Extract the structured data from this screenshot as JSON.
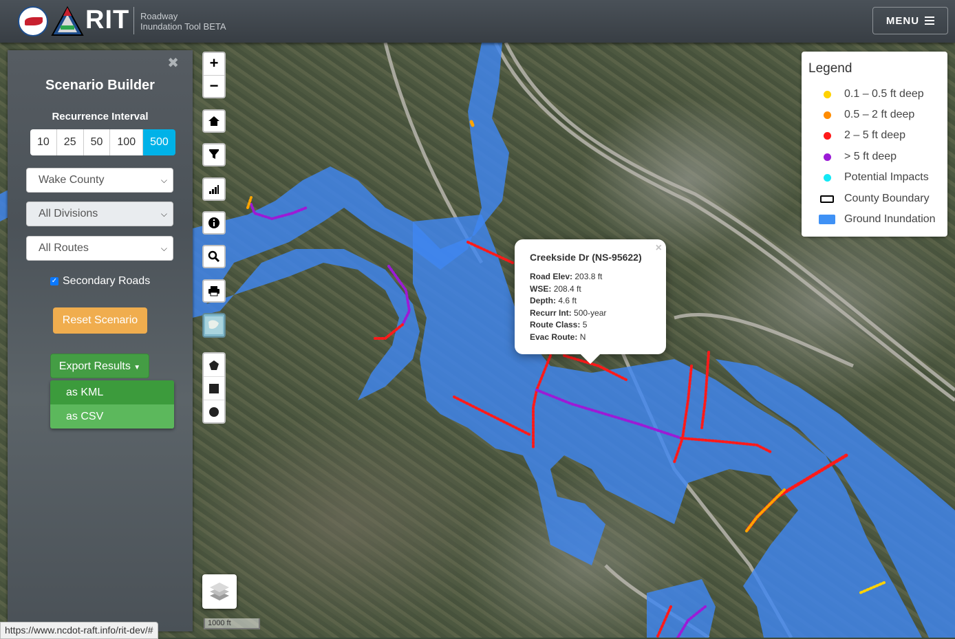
{
  "header": {
    "app_name": "RIT",
    "subtitle_line1": "Roadway",
    "subtitle_line2": "Inundation Tool BETA",
    "menu_label": "MENU"
  },
  "panel": {
    "title": "Scenario Builder",
    "close_glyph": "✖",
    "recurrence_label": "Recurrence Interval",
    "recurrence_options": [
      "10",
      "25",
      "50",
      "100",
      "500"
    ],
    "recurrence_selected": "500",
    "county_select": "Wake County",
    "division_select": "All Divisions",
    "route_select": "All Routes",
    "secondary_roads_label": "Secondary Roads",
    "secondary_roads_checked": true,
    "reset_label": "Reset Scenario",
    "export_label": "Export Results",
    "export_options": [
      "as KML",
      "as CSV"
    ]
  },
  "tools": {
    "zoom_in": "+",
    "zoom_out": "−",
    "icons": [
      "home-icon",
      "filter-icon",
      "chart-icon",
      "info-icon",
      "search-icon",
      "print-icon",
      "minimap-icon",
      "polygon-icon",
      "square-icon",
      "circle-icon",
      "layers-icon"
    ]
  },
  "legend": {
    "title": "Legend",
    "items": [
      {
        "label": "0.1 – 0.5 ft deep",
        "color": "#ffd200",
        "symbol": "dot"
      },
      {
        "label": "0.5 – 2 ft deep",
        "color": "#ff8c00",
        "symbol": "dot"
      },
      {
        "label": "2 – 5 ft deep",
        "color": "#ff1a1a",
        "symbol": "dot"
      },
      {
        "label": "> 5 ft deep",
        "color": "#9b1bd6",
        "symbol": "dot"
      },
      {
        "label": "Potential Impacts",
        "color": "#14e8f5",
        "symbol": "dot"
      },
      {
        "label": "County Boundary",
        "color": "#000000",
        "symbol": "outline"
      },
      {
        "label": "Ground Inundation",
        "color": "#3f91f5",
        "symbol": "fill"
      }
    ]
  },
  "popup": {
    "title": "Creekside Dr (NS-95622)",
    "rows": [
      {
        "key": "Road Elev:",
        "value": "203.8 ft"
      },
      {
        "key": "WSE:",
        "value": "208.4 ft"
      },
      {
        "key": "Depth:",
        "value": "4.6 ft"
      },
      {
        "key": "Recurr Int:",
        "value": "500-year"
      },
      {
        "key": "Route Class:",
        "value": "5"
      },
      {
        "key": "Evac Route:",
        "value": "N"
      }
    ]
  },
  "scale_label": "1000 ft",
  "status_url": "https://www.ncdot-raft.info/rit-dev/#"
}
